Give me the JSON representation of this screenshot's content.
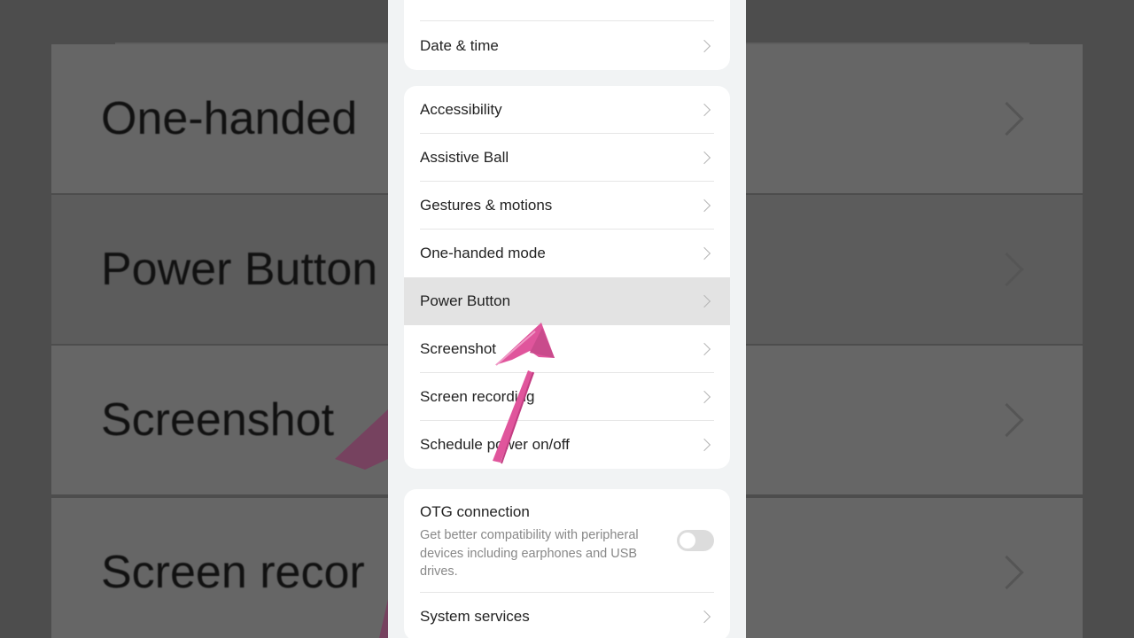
{
  "background": {
    "rows": [
      "One-handed",
      "Power Button",
      "Screenshot",
      "Screen recor"
    ]
  },
  "top_card": {
    "items": [
      {
        "label": "Date & time"
      }
    ]
  },
  "main_card": {
    "items": [
      {
        "label": "Accessibility"
      },
      {
        "label": "Assistive Ball"
      },
      {
        "label": "Gestures & motions"
      },
      {
        "label": "One-handed mode"
      },
      {
        "label": "Power Button"
      },
      {
        "label": "Screenshot"
      },
      {
        "label": "Screen recording"
      },
      {
        "label": "Schedule power on/off"
      }
    ]
  },
  "otg": {
    "title": "OTG connection",
    "description": "Get better compatibility with peripheral devices including earphones and USB drives.",
    "enabled": false
  },
  "system_services": {
    "label": "System services"
  },
  "colors": {
    "highlight": "#e3e3e3",
    "arrow": "#e0559c",
    "screen_bg": "#f1f3f4"
  }
}
